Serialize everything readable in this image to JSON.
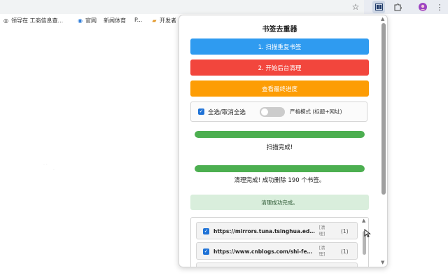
{
  "toolbar": {
    "bookmark_star_icon": "star-icon",
    "extension_icon": "bookmark-cleaner-extension-icon",
    "puzzle_icon": "extensions-puzzle-icon",
    "profile_icon": "profile-avatar-icon",
    "menu_icon": "more-vert-icon"
  },
  "bookmarks_bar": {
    "items": [
      {
        "label": "领导在 工商信息查...",
        "icon": "globe-icon"
      },
      {
        "label": "官网",
        "icon": "globe-icon"
      },
      {
        "label": "新闻体育",
        "icon": ""
      },
      {
        "label": "P...",
        "icon": ""
      },
      {
        "label": "开发者",
        "icon": "folder-icon"
      }
    ]
  },
  "popup": {
    "title": "书签去重器",
    "buttons": {
      "scan": "1. 扫描重复书签",
      "clean": "2. 开始后台清理",
      "progress": "查看最终进度"
    },
    "options": {
      "select_all_label": "全选/取消全选",
      "select_all_checked": true,
      "strict_mode_label": "严格模式 (标题+网址)",
      "strict_mode_on": false
    },
    "scan_progress": {
      "value": 1.0,
      "status": "扫描完成!"
    },
    "clean_progress": {
      "value": 1.0,
      "status": "清理完成! 成功删除 190 个书签。"
    },
    "alert": "清理成功完成。",
    "duplicates": [
      {
        "url": "https://mirrors.tuna.tsinghua.edu.cn/ana...",
        "tag": "[清\n理]",
        "count": "(1)",
        "checked": true
      },
      {
        "url": "https://www.cnblogs.com/shi-feng/archi...",
        "tag": "[清\n理]",
        "count": "(1)",
        "checked": true
      }
    ]
  },
  "colors": {
    "scan_button": "#2f9bf0",
    "clean_button": "#f2463d",
    "progress_button": "#fd9d05",
    "progress_bar": "#4caf50",
    "alert_bg": "#d9eedc"
  }
}
